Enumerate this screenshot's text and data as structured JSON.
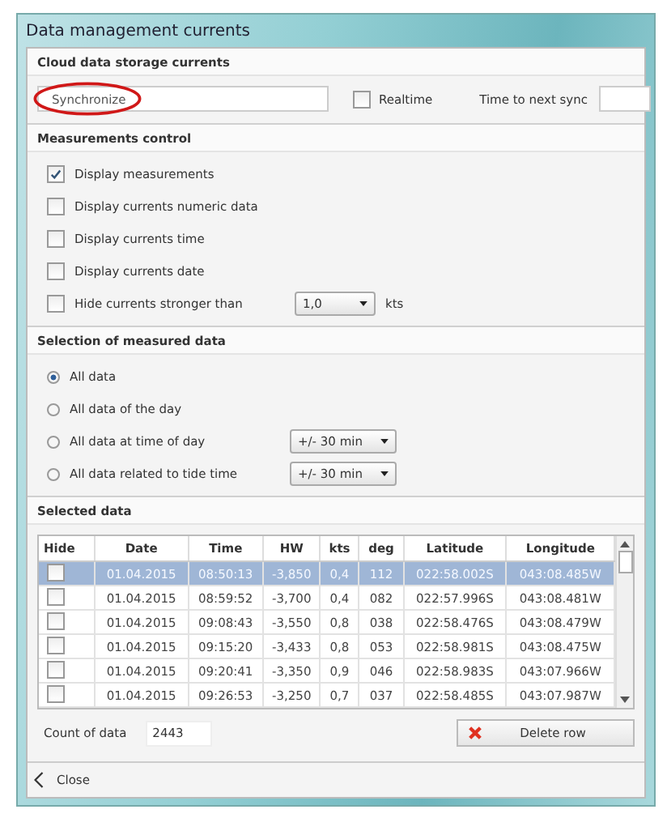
{
  "window": {
    "title": "Data management currents"
  },
  "cloud": {
    "header": "Cloud data storage currents",
    "sync_button": "Synchronize",
    "sync_circled": true,
    "realtime": {
      "label": "Realtime",
      "checked": false
    },
    "next_sync_label": "Time to next sync"
  },
  "measurements": {
    "header": "Measurements control",
    "options": [
      {
        "label": "Display measurements",
        "checked": true
      },
      {
        "label": "Display currents numeric data",
        "checked": false
      },
      {
        "label": "Display currents time",
        "checked": false
      },
      {
        "label": "Display currents date",
        "checked": false
      },
      {
        "label": "Hide currents stronger than",
        "checked": false,
        "dropdown": "1,0",
        "unit": "kts"
      }
    ]
  },
  "selection": {
    "header": "Selection of measured data",
    "options": [
      {
        "label": "All data",
        "selected": true
      },
      {
        "label": "All data of the day",
        "selected": false
      },
      {
        "label": "All data at time of day",
        "selected": false,
        "dropdown": "+/- 30 min"
      },
      {
        "label": "All data related to tide time",
        "selected": false,
        "dropdown": "+/- 30 min"
      }
    ]
  },
  "selected_data": {
    "header": "Selected data",
    "hide_header": "Hide",
    "columns": [
      "Date",
      "Time",
      "HW",
      "kts",
      "deg",
      "Latitude",
      "Longitude"
    ],
    "rows": [
      {
        "hide": false,
        "selected": true,
        "cells": [
          "01.04.2015",
          "08:50:13",
          "-3,850",
          "0,4",
          "112",
          "022:58.002S",
          "043:08.485W"
        ]
      },
      {
        "hide": false,
        "selected": false,
        "cells": [
          "01.04.2015",
          "08:59:52",
          "-3,700",
          "0,4",
          "082",
          "022:57.996S",
          "043:08.481W"
        ]
      },
      {
        "hide": false,
        "selected": false,
        "cells": [
          "01.04.2015",
          "09:08:43",
          "-3,550",
          "0,8",
          "038",
          "022:58.476S",
          "043:08.479W"
        ]
      },
      {
        "hide": false,
        "selected": false,
        "cells": [
          "01.04.2015",
          "09:15:20",
          "-3,433",
          "0,8",
          "053",
          "022:58.981S",
          "043:08.475W"
        ]
      },
      {
        "hide": false,
        "selected": false,
        "cells": [
          "01.04.2015",
          "09:20:41",
          "-3,350",
          "0,9",
          "046",
          "022:58.983S",
          "043:07.966W"
        ]
      },
      {
        "hide": false,
        "selected": false,
        "cells": [
          "01.04.2015",
          "09:26:53",
          "-3,250",
          "0,7",
          "037",
          "022:58.485S",
          "043:07.987W"
        ]
      }
    ],
    "count_label": "Count of data",
    "count": "2443",
    "delete_button": "Delete row"
  },
  "footer": {
    "close": "Close"
  }
}
